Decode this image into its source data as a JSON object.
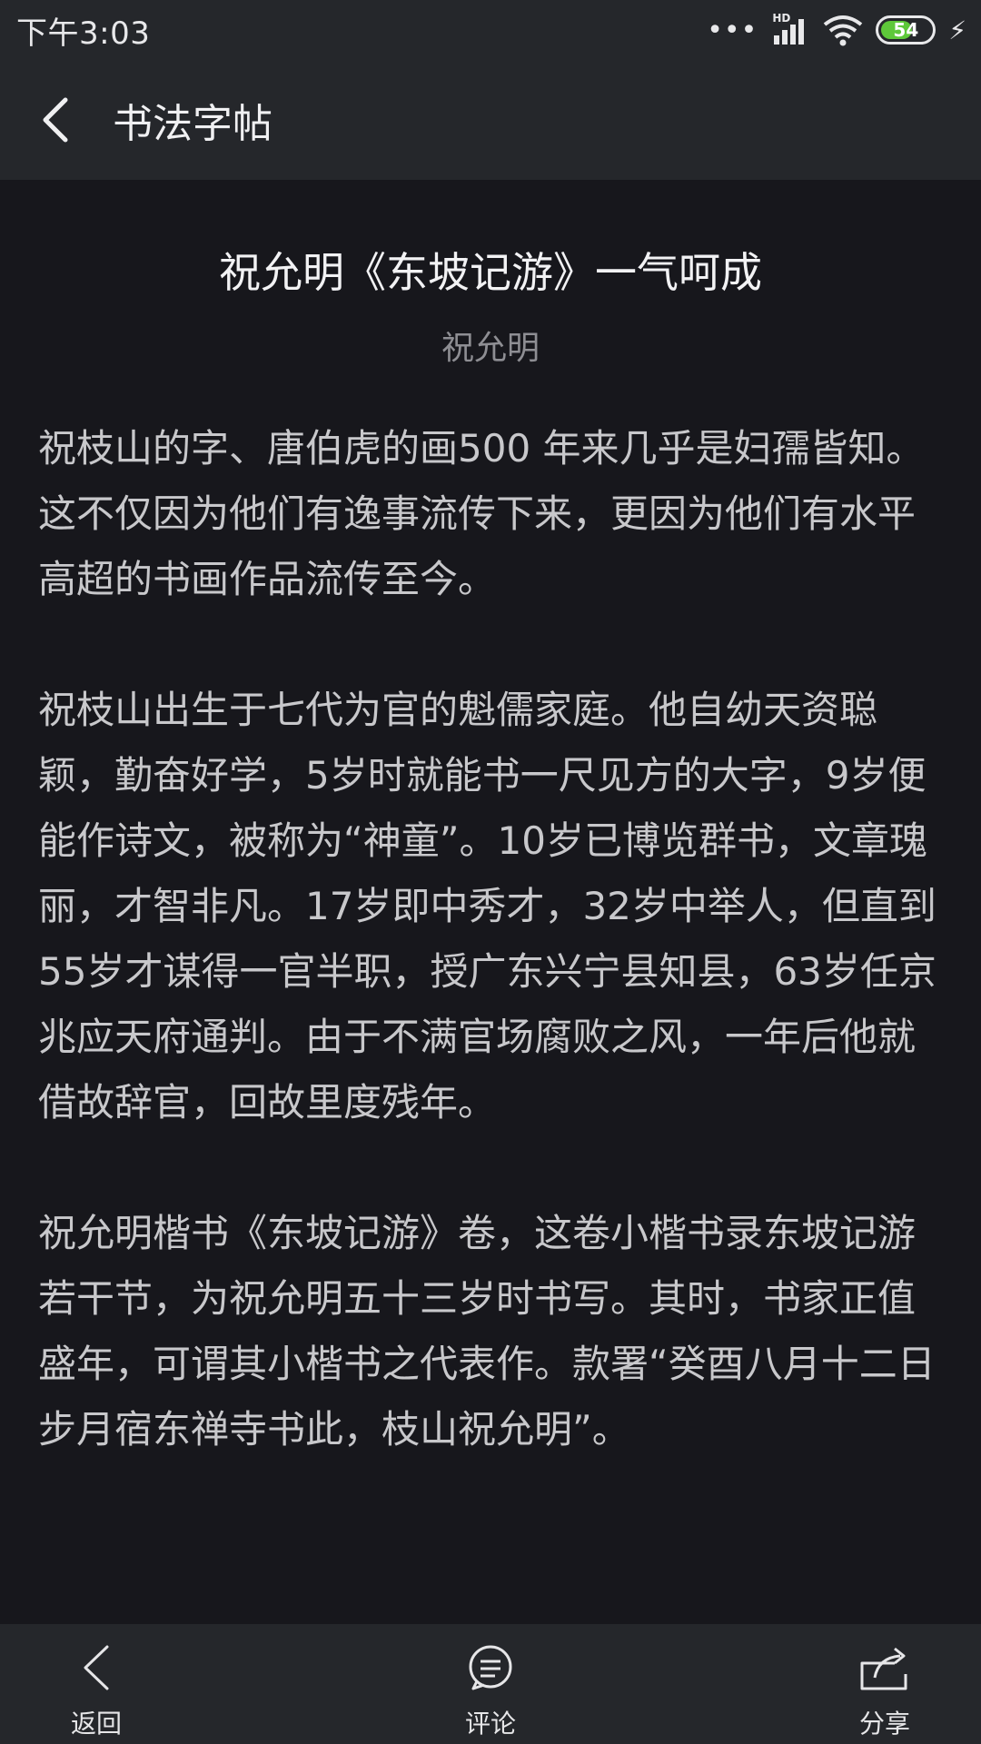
{
  "status_bar": {
    "time": "下午3:03",
    "network": "HD",
    "battery": "54"
  },
  "app_bar": {
    "title": "书法字帖"
  },
  "article": {
    "title": "祝允明《东坡记游》一气呵成",
    "author": "祝允明",
    "paragraphs": [
      "祝枝山的字、唐伯虎的画500 年来几乎是妇孺皆知。这不仅因为他们有逸事流传下来，更因为他们有水平高超的书画作品流传至今。",
      "祝枝山出生于七代为官的魁儒家庭。他自幼天资聪颖，勤奋好学，5岁时就能书一尺见方的大字，9岁便能作诗文，被称为“神童”。10岁已博览群书，文章瑰丽，才智非凡。17岁即中秀才，32岁中举人，但直到55岁才谋得一官半职，授广东兴宁县知县，63岁任京兆应天府通判。由于不满官场腐败之风，一年后他就借故辞官，回故里度残年。",
      "祝允明楷书《东坡记游》卷，这卷小楷书录东坡记游若干节，为祝允明五十三岁时书写。其时，书家正值盛年，可谓其小楷书之代表作。款署“癸酉八月十二日步月宿东禅寺书此，枝山祝允明”。"
    ]
  },
  "bottom_nav": {
    "back_label": "返回",
    "comment_label": "评论",
    "share_label": "分享"
  }
}
